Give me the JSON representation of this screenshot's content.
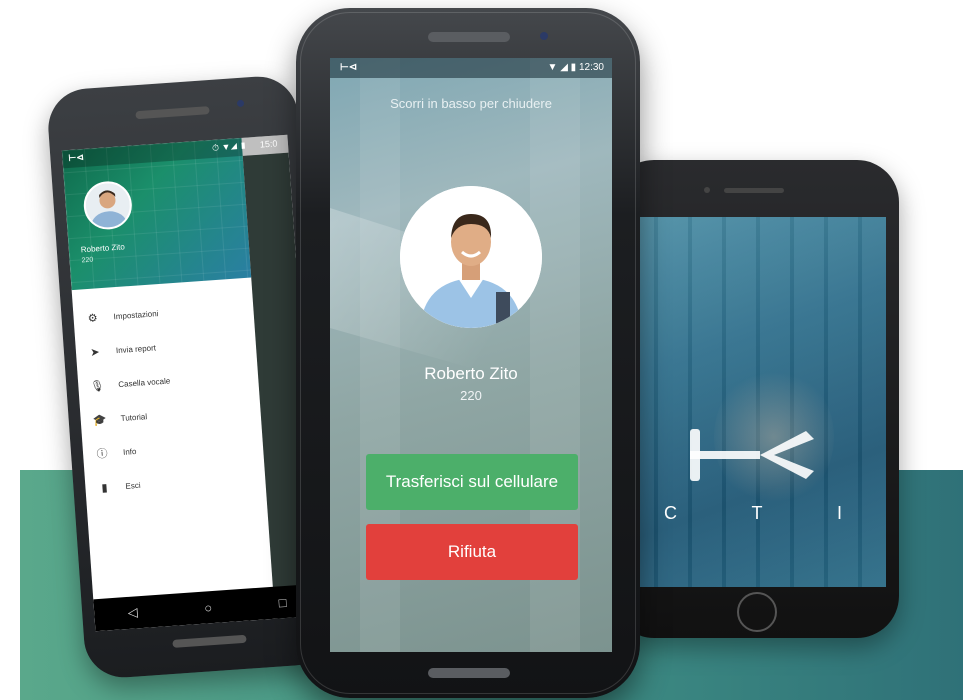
{
  "colors": {
    "background_band": "#4a9a86",
    "accept_button": "#4caf6a",
    "reject_button": "#e2403c",
    "drawer_header": "#1b8f6b"
  },
  "left_phone": {
    "status_time": "15:0",
    "user": {
      "name": "Roberto Zito",
      "extension": "220"
    },
    "menu": [
      {
        "icon": "settings-icon",
        "label": "Impostazioni"
      },
      {
        "icon": "send-icon",
        "label": "Invia report"
      },
      {
        "icon": "microphone-icon",
        "label": "Casella vocale"
      },
      {
        "icon": "graduation-cap-icon",
        "label": "Tutorial"
      },
      {
        "icon": "info-icon",
        "label": "Info"
      },
      {
        "icon": "exit-icon",
        "label": "Esci"
      }
    ],
    "nav": {
      "back": "◁",
      "home": "○",
      "recent": "□"
    }
  },
  "center_phone": {
    "status_time": "12:30",
    "hint": "Scorri in basso per chiudere",
    "caller": {
      "name": "Roberto Zito",
      "extension": "220"
    },
    "transfer_button": "Trasferisci sul cellulare",
    "reject_button": "Rifiuta"
  },
  "right_phone": {
    "logo_letters": [
      "C",
      "T",
      "I"
    ]
  }
}
